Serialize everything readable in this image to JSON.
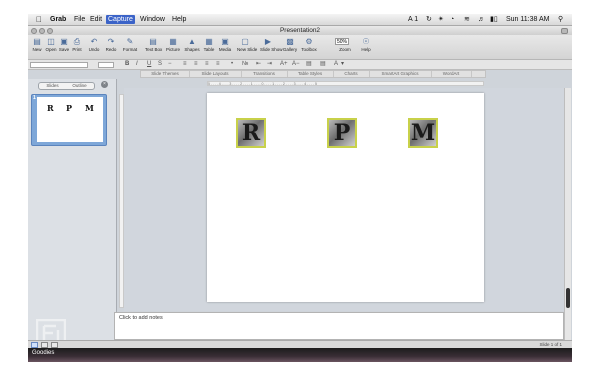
{
  "menubar": {
    "apple": "",
    "items": [
      "Grab",
      "File",
      "Edit",
      "Capture",
      "Window",
      "Help"
    ],
    "active": "Capture",
    "status": {
      "a_one": "A 1",
      "clock": "Sun 11:38 AM"
    }
  },
  "window": {
    "title": "Presentation2"
  },
  "toolbar": {
    "buttons": [
      "New",
      "Open",
      "Save",
      "Print",
      "Undo",
      "Redo",
      "Format",
      "Text Box",
      "Picture",
      "Shapes",
      "Table",
      "Media",
      "New Slide",
      "Slide Show",
      "Gallery",
      "Toolbox",
      "Zoom",
      "Help"
    ],
    "zoom_value": "50%"
  },
  "ribbon": {
    "tabs": [
      "Slide Themes",
      "Slide Layouts",
      "Transitions",
      "Table Styles",
      "Charts",
      "SmartArt Graphics",
      "WordArt"
    ]
  },
  "ruler": {
    "marks": "5 . . . . 4 . . . . 3 . . . . 2 . . . . 1 . . . . 0 . . . . 1 . . . . 2 . . . . 3 . . . . 4 . . . . 5"
  },
  "left_panel": {
    "tabs": [
      "Slides",
      "Outline"
    ],
    "slide_number": "1",
    "thumb_letters": [
      "R",
      "P",
      "M"
    ]
  },
  "slide": {
    "letters": [
      "R",
      "P",
      "M"
    ]
  },
  "notes": {
    "placeholder": "Click to add notes"
  },
  "status": {
    "slide_count": "Slide 1 of 1"
  },
  "dock": {
    "label": "Goodies"
  },
  "colors": {
    "menu_active": "#3b63c8",
    "tile_border": "#c8d14a",
    "thumb_selection": "#7ea7d8"
  }
}
